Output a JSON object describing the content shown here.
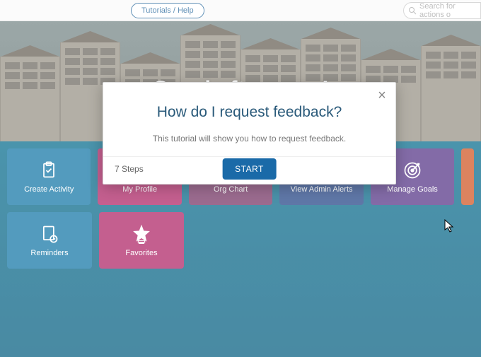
{
  "topbar": {
    "tutorials_label": "Tutorials / Help",
    "search_placeholder": "Search for actions o"
  },
  "banner": {
    "greeting": "Good afternoon!"
  },
  "tiles": {
    "row1": [
      {
        "label": "Create Activity",
        "icon": "clipboard-icon",
        "colorClass": "blue"
      },
      {
        "label": "My Profile",
        "icon": "user-icon",
        "colorClass": "magenta"
      },
      {
        "label": "Org Chart",
        "icon": "orgchart-icon",
        "colorClass": "plum"
      },
      {
        "label": "View Admin Alerts",
        "icon": "bell-icon",
        "colorClass": "navy"
      },
      {
        "label": "Manage Goals",
        "icon": "target-icon",
        "colorClass": "violet"
      },
      {
        "label": "",
        "icon": "",
        "colorClass": "orange partial"
      }
    ],
    "row2": [
      {
        "label": "Reminders",
        "icon": "reminder-icon",
        "colorClass": "blue"
      },
      {
        "label": "Favorites",
        "icon": "star-icon",
        "colorClass": "magenta"
      }
    ]
  },
  "modal": {
    "title": "How do I request feedback?",
    "desc": "This tutorial will show you how to request feedback.",
    "steps": "7 Steps",
    "start": "START"
  }
}
